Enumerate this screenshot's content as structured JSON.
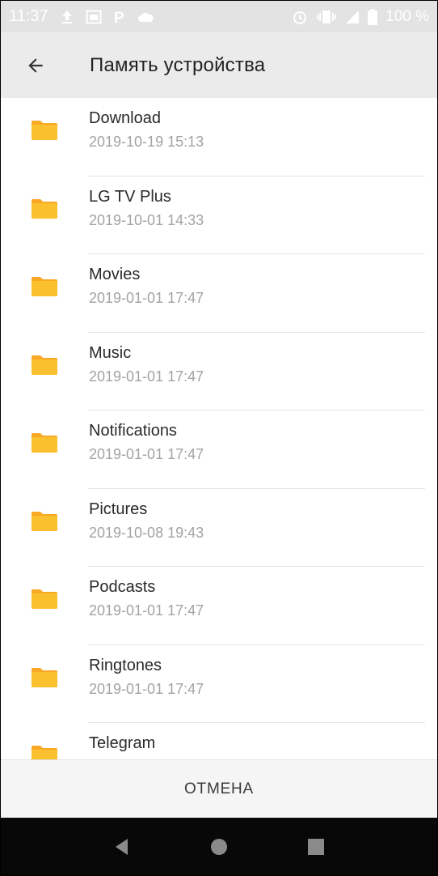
{
  "status_bar": {
    "time": "11:37",
    "battery_text": "100 %",
    "left_icons": [
      "upload-icon",
      "screenshot-icon",
      "p-app-icon",
      "cloud-icon"
    ],
    "right_icons": [
      "alarm-icon",
      "vibrate-icon",
      "signal-icon",
      "battery-icon"
    ],
    "p_glyph": "P"
  },
  "app_bar": {
    "title": "Память устройства",
    "back_icon": "arrow-back-icon"
  },
  "files": [
    {
      "name": "Download",
      "date": "2019-10-19 15:13",
      "icon": "folder-icon"
    },
    {
      "name": "LG TV Plus",
      "date": "2019-10-01 14:33",
      "icon": "folder-icon"
    },
    {
      "name": "Movies",
      "date": "2019-01-01 17:47",
      "icon": "folder-icon"
    },
    {
      "name": "Music",
      "date": "2019-01-01 17:47",
      "icon": "folder-icon"
    },
    {
      "name": "Notifications",
      "date": "2019-01-01 17:47",
      "icon": "folder-icon"
    },
    {
      "name": "Pictures",
      "date": "2019-10-08 19:43",
      "icon": "folder-icon"
    },
    {
      "name": "Podcasts",
      "date": "2019-01-01 17:47",
      "icon": "folder-icon"
    },
    {
      "name": "Ringtones",
      "date": "2019-01-01 17:47",
      "icon": "folder-icon"
    },
    {
      "name": "Telegram",
      "date": "",
      "icon": "folder-icon"
    }
  ],
  "footer": {
    "cancel_label": "ОТМЕНА"
  },
  "nav_bar": {
    "buttons": [
      "nav-back-icon",
      "nav-home-icon",
      "nav-recents-icon"
    ]
  },
  "colors": {
    "folder": "#fbc02d",
    "folder_tab": "#f9a825",
    "app_bar_bg": "#ebebeb",
    "status_bar_bg": "#e3e3e3",
    "nav_bar_bg": "#080808"
  }
}
